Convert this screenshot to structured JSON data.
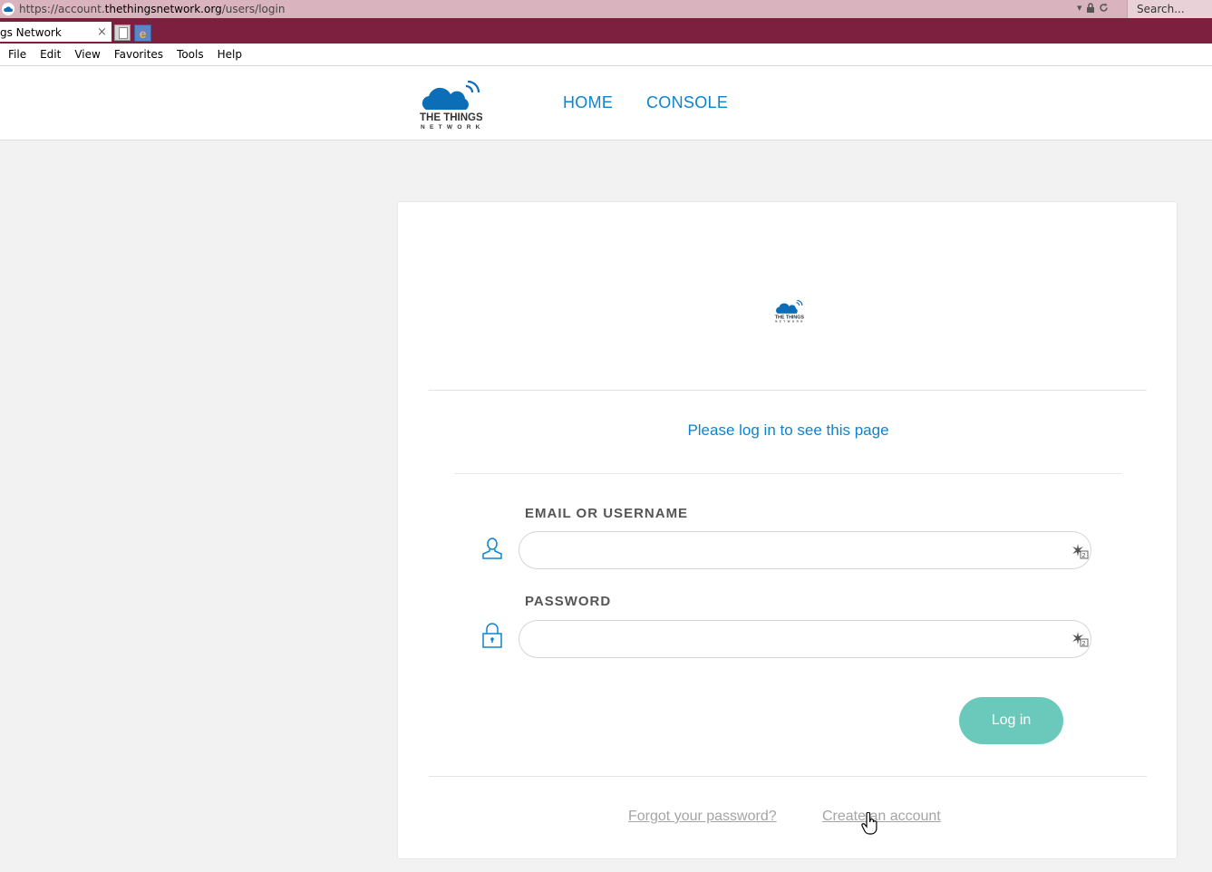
{
  "browser": {
    "url_prefix": "https://account.",
    "url_domain": "thethingsnetwork.org",
    "url_path": "/users/login",
    "search_placeholder": "Search...",
    "tab_title": "gs Network",
    "tab_close": "×",
    "menu": [
      "File",
      "Edit",
      "View",
      "Favorites",
      "Tools",
      "Help"
    ]
  },
  "header": {
    "nav": [
      "HOME",
      "CONSOLE"
    ]
  },
  "card": {
    "prompt": "Please log in to see this page",
    "email_label": "EMAIL OR USERNAME",
    "email_value": "",
    "password_label": "PASSWORD",
    "password_value": "",
    "login_button": "Log in",
    "forgot_link": "Forgot your password?",
    "create_link": "Create an account"
  },
  "colors": {
    "brand_blue": "#0d83d0",
    "button_teal": "#6bc9bb",
    "tabbar": "#7d1f3e"
  }
}
